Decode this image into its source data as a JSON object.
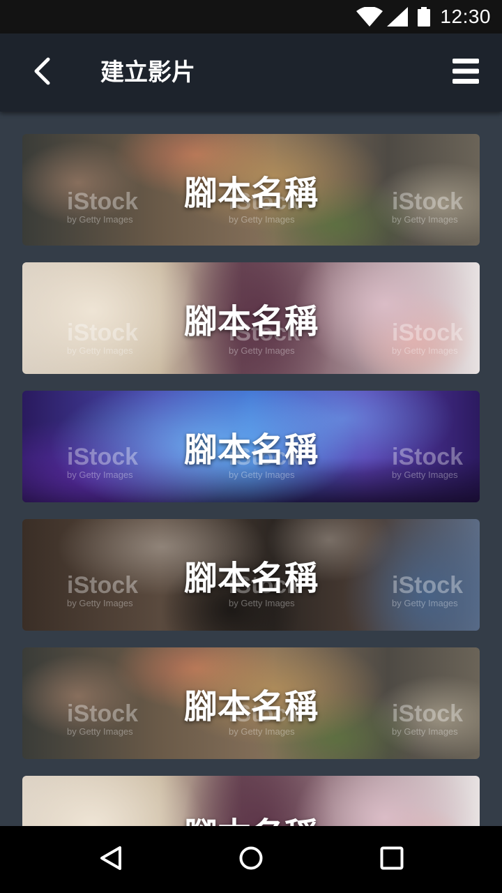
{
  "status_bar": {
    "time": "12:30"
  },
  "app_bar": {
    "title": "建立影片"
  },
  "scripts": [
    {
      "label": "腳本名稱",
      "image": "food"
    },
    {
      "label": "腳本名稱",
      "image": "wedding"
    },
    {
      "label": "腳本名稱",
      "image": "concert"
    },
    {
      "label": "腳本名稱",
      "image": "music"
    },
    {
      "label": "腳本名稱",
      "image": "food"
    },
    {
      "label": "腳本名稱",
      "image": "wedding"
    }
  ],
  "watermark": {
    "brand": "iStock",
    "sub": "by Getty Images"
  },
  "icons": {
    "back": "chevron-left-icon",
    "menu": "hamburger-menu-icon",
    "wifi": "wifi-icon",
    "signal": "signal-icon",
    "battery": "battery-icon",
    "nav_back": "nav-back-icon",
    "nav_home": "nav-home-icon",
    "nav_recents": "nav-recents-icon"
  },
  "colors": {
    "background": "#343d48",
    "app_bar": "#1d232c",
    "status_bar": "#131313"
  }
}
